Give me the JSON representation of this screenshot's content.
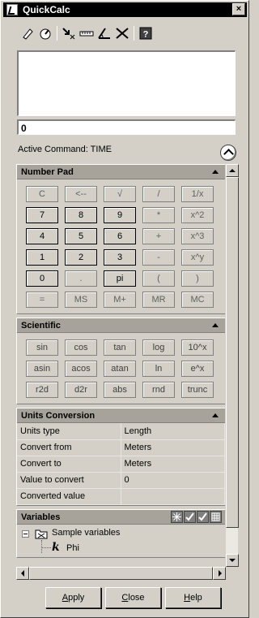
{
  "window": {
    "title": "QuickCalc",
    "close_glyph": "×"
  },
  "toolbar": {
    "buttons": [
      {
        "icon": "eraser-icon"
      },
      {
        "icon": "paste-icon"
      },
      {
        "icon": "get-coordinates-icon"
      },
      {
        "icon": "distance-icon"
      },
      {
        "icon": "angle-icon"
      },
      {
        "icon": "intersection-icon"
      },
      {
        "icon": "help-icon"
      }
    ]
  },
  "display": {
    "history": "",
    "input_value": "0"
  },
  "active_command": "Active Command: TIME",
  "number_pad": {
    "title": "Number Pad",
    "buttons": [
      "C",
      "<--",
      "√",
      "/",
      "1/x",
      "7",
      "8",
      "9",
      "*",
      "x^2",
      "4",
      "5",
      "6",
      "+",
      "x^3",
      "1",
      "2",
      "3",
      "-",
      "x^y",
      "0",
      ".",
      "pi",
      "(",
      ")",
      "=",
      "MS",
      "M+",
      "MR",
      "MC"
    ]
  },
  "scientific": {
    "title": "Scientific",
    "buttons": [
      "sin",
      "cos",
      "tan",
      "log",
      "10^x",
      "asin",
      "acos",
      "atan",
      "ln",
      "e^x",
      "r2d",
      "d2r",
      "abs",
      "rnd",
      "trunc"
    ]
  },
  "units_conversion": {
    "title": "Units Conversion",
    "rows": [
      {
        "label": "Units type",
        "value": "Length"
      },
      {
        "label": "Convert from",
        "value": "Meters"
      },
      {
        "label": "Convert to",
        "value": "Meters"
      },
      {
        "label": "Value to convert",
        "value": "0"
      },
      {
        "label": "Converted value",
        "value": ""
      }
    ]
  },
  "variables": {
    "title": "Variables",
    "tree_root": "Sample variables",
    "tree_child": "Phi",
    "tree_child_glyph": "k"
  },
  "actions": {
    "apply_prefix": "A",
    "apply_rest": "pply",
    "close_prefix": "C",
    "close_rest": "lose",
    "help_prefix": "H",
    "help_rest": "elp"
  }
}
